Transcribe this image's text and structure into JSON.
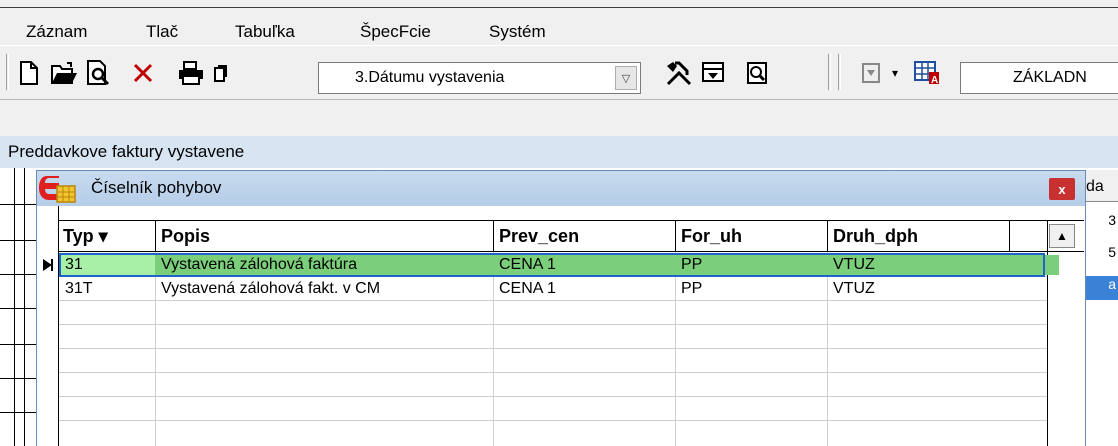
{
  "menu": {
    "items": [
      "Záznam",
      "Tlač",
      "Tabuľka",
      "ŠpecFcie",
      "Systém"
    ]
  },
  "toolbar": {
    "sort_combo_value": "3.Dátumu vystavenia",
    "view_combo_value": "ZÁKLADN"
  },
  "main_window": {
    "title": "Preddavkove faktury vystavene",
    "right_col_header": "da",
    "right_col_values": [
      "3",
      "5",
      "a"
    ]
  },
  "dialog": {
    "title": "Číselník pohybov",
    "close_label": "x",
    "columns": [
      "Typ ▾",
      "Popis",
      "Prev_cen",
      "For_uh",
      "Druh_dph"
    ],
    "rows": [
      [
        "31",
        "Vystavená zálohová faktúra",
        "CENA 1",
        "PP",
        "VTUZ"
      ],
      [
        "31T",
        "Vystavená zálohová fakt. v CM",
        "CENA 1",
        "PP",
        "VTUZ"
      ]
    ]
  },
  "colors": {
    "selected_row": "#7bcf7b",
    "selection_border": "#1f64c8",
    "title_bar": "#c8dbef",
    "close_button": "#c8312f"
  }
}
